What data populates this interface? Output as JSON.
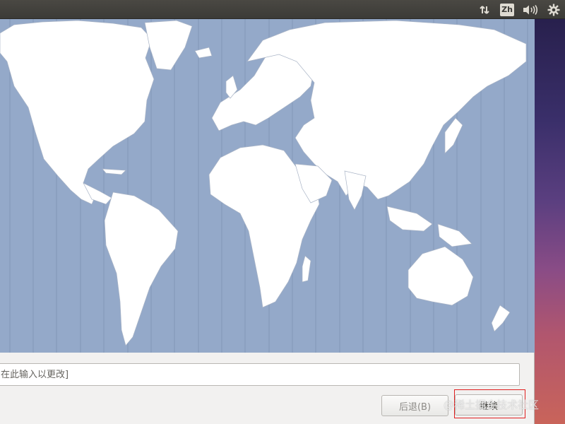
{
  "top_panel": {
    "network_icon": "network-arrows-icon",
    "keyboard_layout": "Zh",
    "sound_icon": "volume-icon",
    "session_icon": "gear-icon"
  },
  "installer": {
    "location_placeholder": "在此输入以更改]",
    "back_label": "后退(B)",
    "continue_label": "继续"
  },
  "watermark": "@稀土掘金技术社区",
  "colors": {
    "ocean": "#94a9c9",
    "land": "#ffffff",
    "panel": "#3c3b37",
    "window": "#f2f1f0"
  }
}
